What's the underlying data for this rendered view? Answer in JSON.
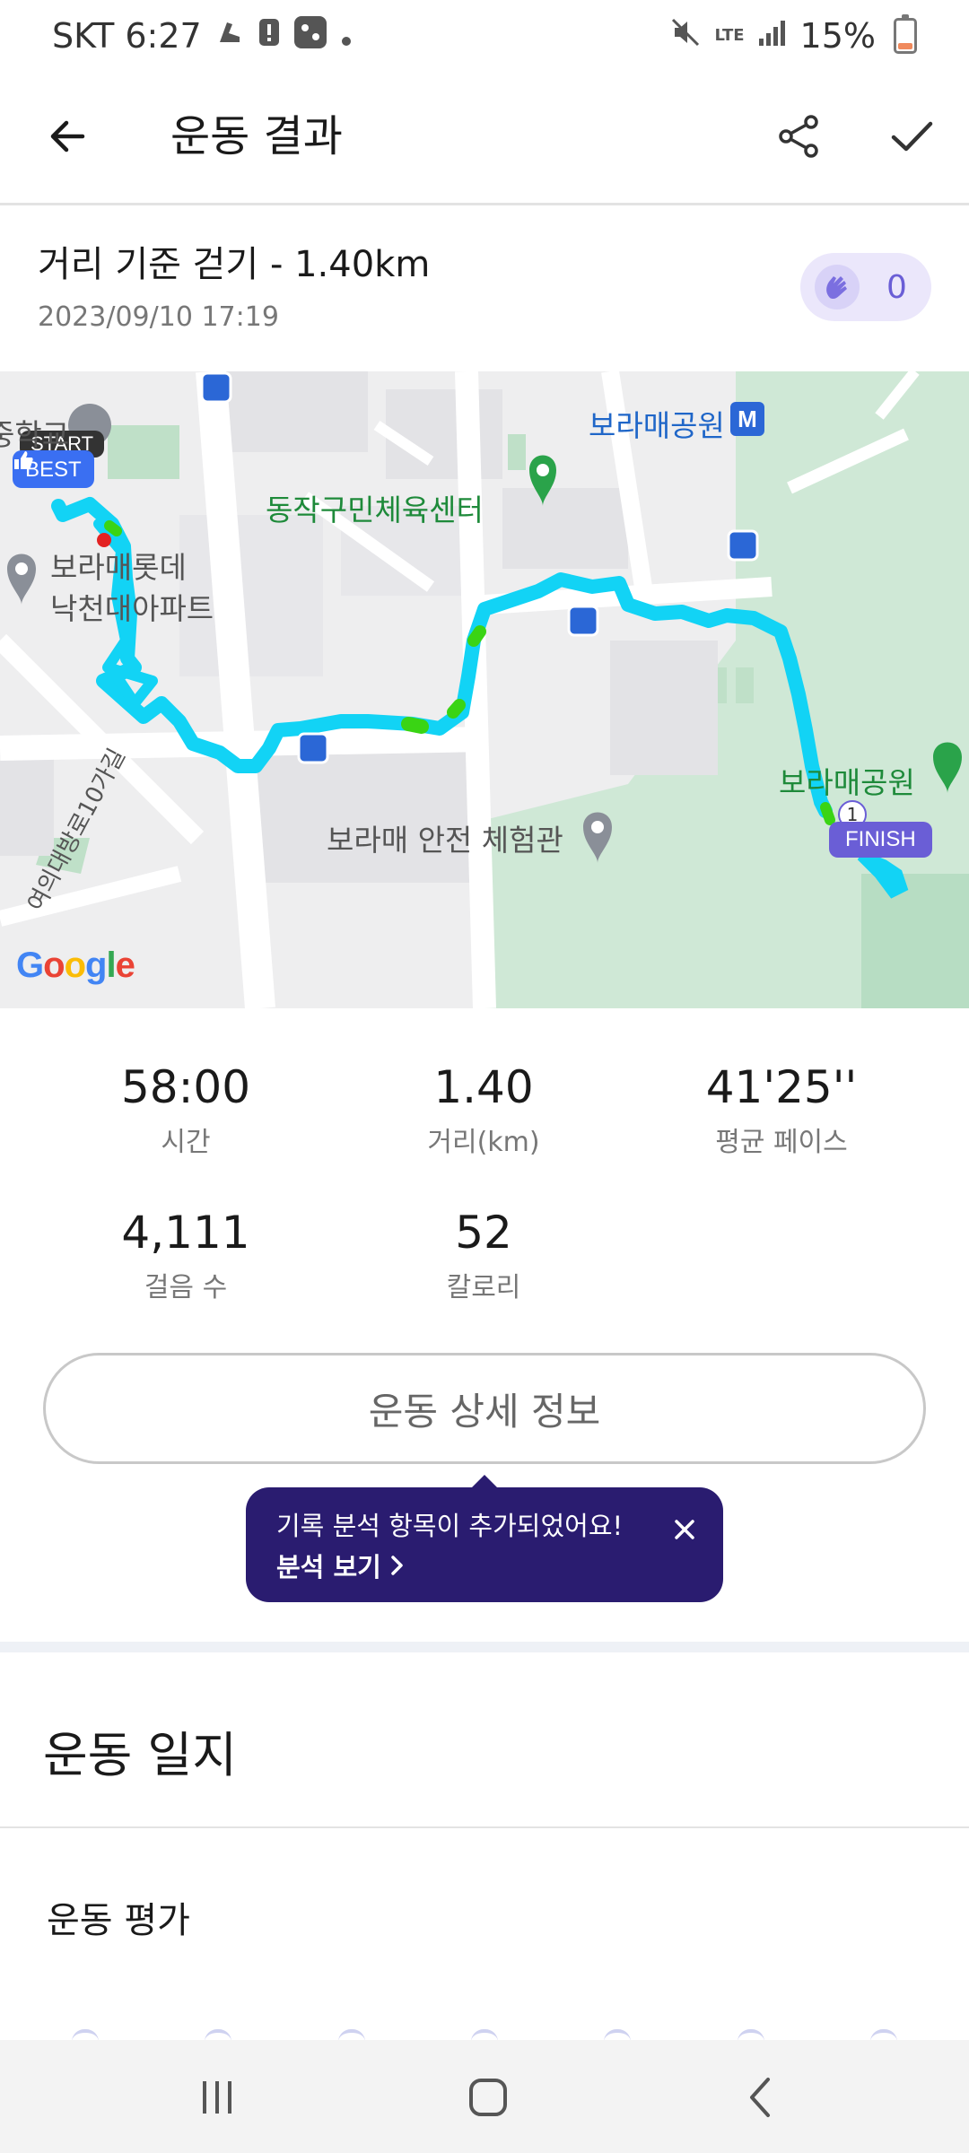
{
  "status_bar": {
    "carrier_time": "SKT 6:27",
    "network": "LTE",
    "battery": "15%"
  },
  "app_bar": {
    "title": "운동 결과"
  },
  "workout": {
    "title": "거리 기준 걷기 - 1.40km",
    "date": "2023/09/10 17:19",
    "clap_count": "0"
  },
  "map": {
    "labels": {
      "school": "중학교",
      "sports_center": "동작구민체육센터",
      "apartment_line1": "보라매롯데",
      "apartment_line2": "낙천대아파트",
      "park_station": "보라매공원",
      "park": "보라매공원",
      "safety_center": "보라매 안전 체험관",
      "road": "여의대방로10가길",
      "google": "Google"
    },
    "markers": {
      "start": "START",
      "best": "BEST",
      "finish": "FINISH",
      "split": "1",
      "metro": "M"
    }
  },
  "stats": [
    {
      "value": "58:00",
      "label": "시간"
    },
    {
      "value": "1.40",
      "label": "거리(km)"
    },
    {
      "value": "41'25''",
      "label": "평균 페이스"
    },
    {
      "value": "4,111",
      "label": "걸음 수"
    },
    {
      "value": "52",
      "label": "칼로리"
    }
  ],
  "details_button": "운동 상세 정보",
  "tooltip": {
    "message": "기록 분석 항목이 추가되었어요!",
    "link": "분석 보기"
  },
  "journal": {
    "title": "운동 일지",
    "evaluation_label": "운동 평가"
  },
  "colors": {
    "accent": "#6a5ed6",
    "tooltip_bg": "#2a1c70",
    "route": "#12d3f5",
    "route_fast": "#3ad414"
  }
}
